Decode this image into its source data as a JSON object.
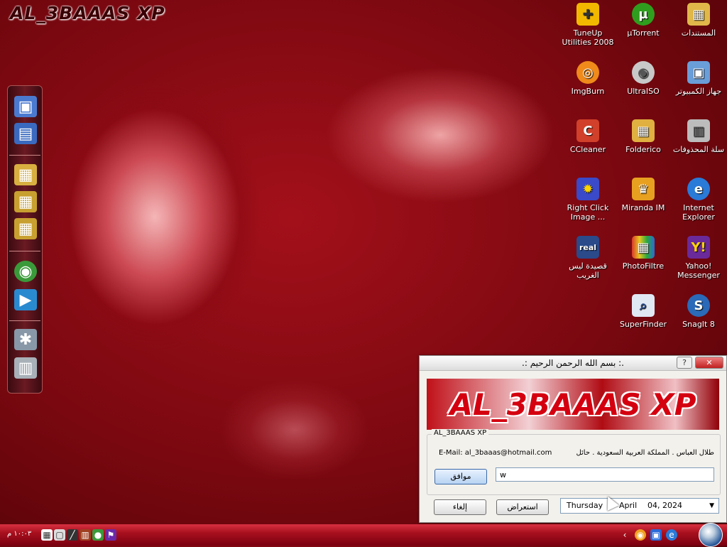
{
  "desktop": {
    "brand": "AL_3BAAAS XP",
    "icons": [
      {
        "id": "tuneup",
        "label": "TuneUp Utilities 2008",
        "icon": "tuneup-icon",
        "color": "#f2b800"
      },
      {
        "id": "utorrent",
        "label": "µTorrent",
        "icon": "utorrent-icon",
        "color": "#2f9e1e"
      },
      {
        "id": "documents",
        "label": "المستندات",
        "icon": "folder-icon",
        "color": "#e0b84a"
      },
      {
        "id": "imgburn",
        "label": "ImgBurn",
        "icon": "imgburn-icon",
        "color": "#f08a1a"
      },
      {
        "id": "ultraiso",
        "label": "UltraISO",
        "icon": "disc-icon",
        "color": "#c8c8c8"
      },
      {
        "id": "mycomputer",
        "label": "جهاز الكمبيوتر",
        "icon": "computer-icon",
        "color": "#6a9ed8"
      },
      {
        "id": "ccleaner",
        "label": "CCleaner",
        "icon": "ccleaner-icon",
        "color": "#d0402a"
      },
      {
        "id": "folderico",
        "label": "Folderico",
        "icon": "folderico-icon",
        "color": "#e0b040"
      },
      {
        "id": "recycle",
        "label": "سلة المحذوفات",
        "icon": "recycle-bin-icon",
        "color": "#bcbcbc"
      },
      {
        "id": "rightclick",
        "label": "Right Click Image ...",
        "icon": "gear-icon",
        "color": "#3a4ac8"
      },
      {
        "id": "miranda",
        "label": "Miranda IM",
        "icon": "miranda-icon",
        "color": "#e8a020"
      },
      {
        "id": "ie",
        "label": "Internet Explorer",
        "icon": "internet-explorer-icon",
        "color": "#2a7ad8"
      },
      {
        "id": "real",
        "label": "قصيدة ليس الغريب",
        "icon": "real-player-icon",
        "color": "#2a4a8a"
      },
      {
        "id": "photofiltre",
        "label": "PhotoFiltre",
        "icon": "photofiltre-icon",
        "color": "#d84a2a"
      },
      {
        "id": "yahoo",
        "label": "Yahoo! Messenger",
        "icon": "yahoo-messenger-icon",
        "color": "#6a2a9a"
      },
      {
        "id": "superfinder",
        "label": "SuperFinder",
        "icon": "superfinder-icon",
        "color": "#8ab0e0"
      },
      {
        "id": "snagit",
        "label": "SnagIt 8",
        "icon": "snagit-icon",
        "color": "#2a6ab8"
      }
    ]
  },
  "dock": {
    "items": [
      {
        "icon": "computer-icon",
        "glyph": "▣",
        "color": "#4a7ad0"
      },
      {
        "icon": "desktop-icon",
        "glyph": "▤",
        "color": "#3a6ac0"
      },
      {
        "icon": "folder-icon",
        "glyph": "▦",
        "color": "#d8b040"
      },
      {
        "icon": "documents-folder-icon",
        "glyph": "▦",
        "color": "#c8a030"
      },
      {
        "icon": "pictures-folder-icon",
        "glyph": "▦",
        "color": "#c8a030"
      },
      {
        "icon": "globe-icon",
        "glyph": "◉",
        "color": "#3a9a3a"
      },
      {
        "icon": "media-player-icon",
        "glyph": "▶",
        "color": "#2a8ad0"
      },
      {
        "icon": "settings-icon",
        "glyph": "✱",
        "color": "#8898a8"
      },
      {
        "icon": "recycle-bin-icon",
        "glyph": "▥",
        "color": "#a8b0b8"
      }
    ]
  },
  "dialog": {
    "title": ".:  بسم الله الرحمن الرحيم  :.",
    "help": "?",
    "close": "✕",
    "banner": "AL_3BAAAS XP",
    "group_label": "AL_3BAAAS XP",
    "email": "E-Mail: al_3baaas@hotmail.com",
    "author": "طلال العباس . المملكة العربية السعودية . حائل",
    "input_value": "w",
    "ok_label": "موافق",
    "cancel_label": "إلغاء",
    "browse_label": "استعراض",
    "date": {
      "day": "Thursday",
      "month": "April",
      "day_year": "04, 2024"
    }
  },
  "taskbar": {
    "clock": "١٠:٠٣ م",
    "quicklaunch": [
      "calendar-icon",
      "window-icon",
      "tool-icon",
      "network-icon",
      "people-icon",
      "flag-icon"
    ],
    "tray": [
      "chevron-left-icon",
      "media-icon",
      "monitor-icon",
      "internet-explorer-icon"
    ]
  }
}
